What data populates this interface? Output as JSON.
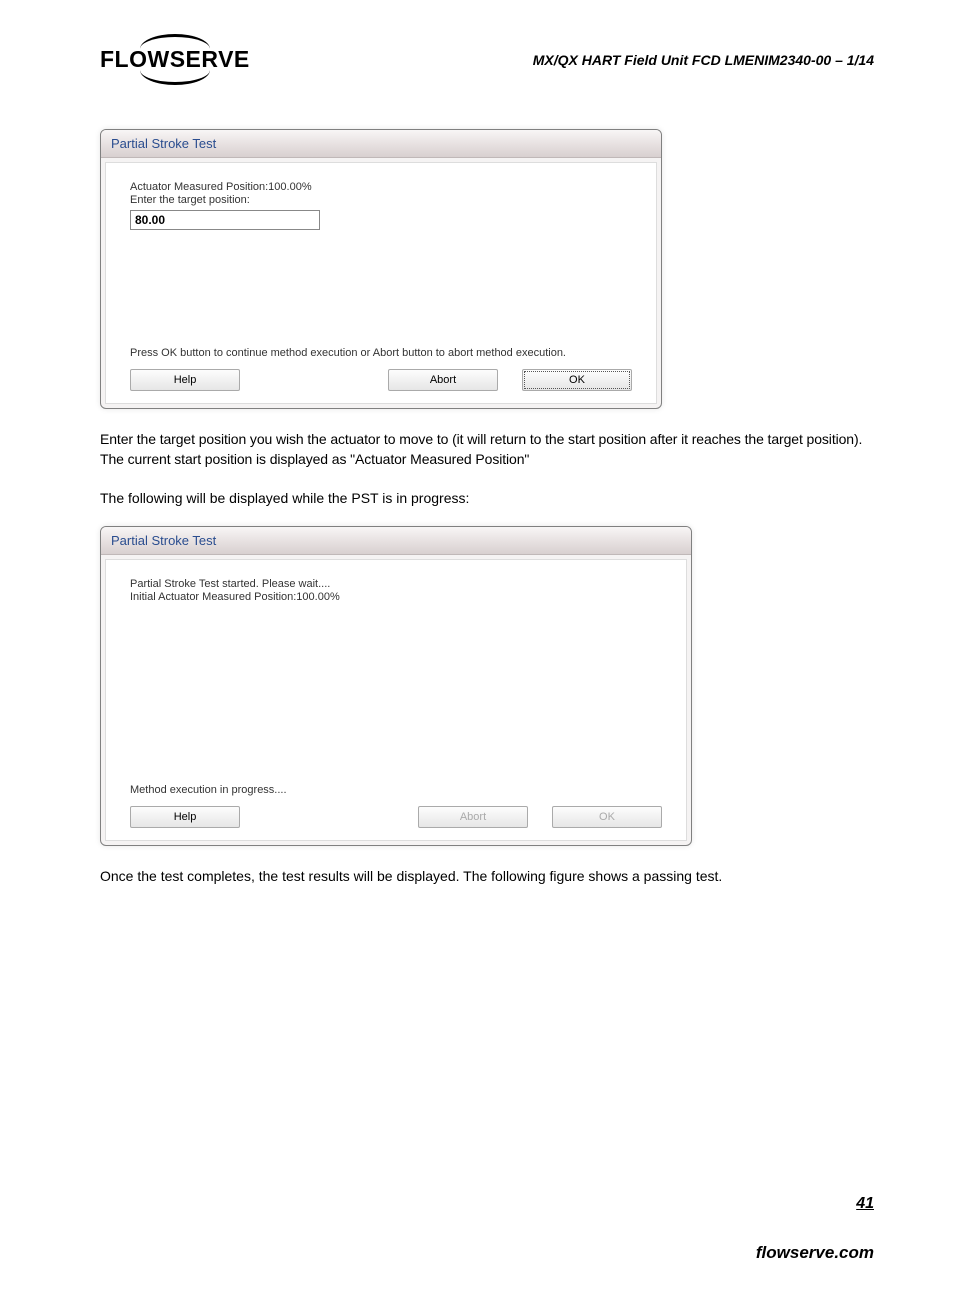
{
  "header": {
    "logo_text": "FLOWSERVE",
    "doc_title": "MX/QX HART Field Unit   FCD LMENIM2340-00 – 1/14"
  },
  "dialog1": {
    "title": "Partial Stroke Test",
    "measured_label": "Actuator Measured Position:100.00%",
    "enter_label": "Enter the target position:",
    "input_value": "80.00",
    "instruction": "Press OK button to continue method execution or Abort button to abort method execution.",
    "buttons": {
      "help": "Help",
      "abort": "Abort",
      "ok": "OK"
    }
  },
  "paragraph1": "Enter the target position you wish the actuator to move to (it will return to the start position after it reaches the target position). The current start position is displayed as \"Actuator Measured Position\"",
  "paragraph2": "The following will be displayed while the PST is in progress:",
  "dialog2": {
    "title": "Partial Stroke Test",
    "line1": "Partial Stroke Test started.  Please wait....",
    "line2": "Initial Actuator Measured Position:100.00%",
    "progress_text": "Method execution in progress....",
    "buttons": {
      "help": "Help",
      "abort": "Abort",
      "ok": "OK"
    }
  },
  "paragraph3": "Once the test completes, the test results will be displayed. The following figure shows a passing test.",
  "footer": {
    "page_number": "41",
    "site": "flowserve.com"
  }
}
